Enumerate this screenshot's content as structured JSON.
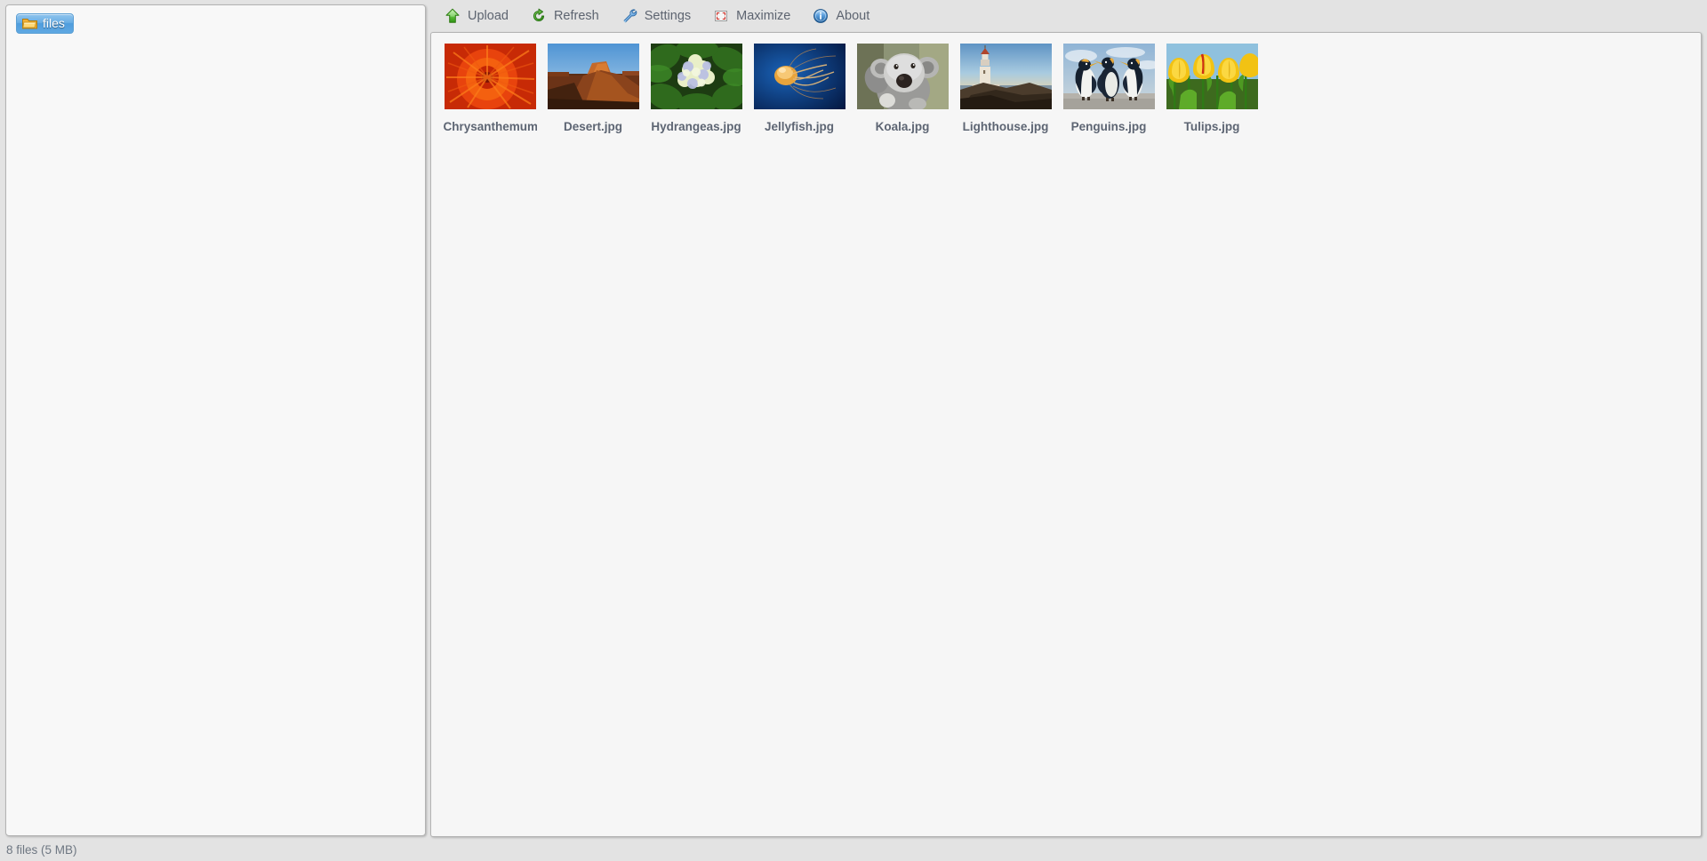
{
  "tree": {
    "root_label": "files",
    "root_icon": "folder-icon",
    "selected": true
  },
  "toolbar": {
    "items": [
      {
        "label": "Upload",
        "icon": "upload-arrow-icon"
      },
      {
        "label": "Refresh",
        "icon": "refresh-icon"
      },
      {
        "label": "Settings",
        "icon": "wrench-icon"
      },
      {
        "label": "Maximize",
        "icon": "maximize-icon"
      },
      {
        "label": "About",
        "icon": "info-icon"
      }
    ]
  },
  "content": {
    "files": [
      {
        "name": "Chrysanthemum.jpg",
        "display": "Chrysanthemum",
        "thumb": "chrysanthemum"
      },
      {
        "name": "Desert.jpg",
        "display": "Desert.jpg",
        "thumb": "desert"
      },
      {
        "name": "Hydrangeas.jpg",
        "display": "Hydrangeas.jpg",
        "thumb": "hydrangeas"
      },
      {
        "name": "Jellyfish.jpg",
        "display": "Jellyfish.jpg",
        "thumb": "jellyfish"
      },
      {
        "name": "Koala.jpg",
        "display": "Koala.jpg",
        "thumb": "koala"
      },
      {
        "name": "Lighthouse.jpg",
        "display": "Lighthouse.jpg",
        "thumb": "lighthouse"
      },
      {
        "name": "Penguins.jpg",
        "display": "Penguins.jpg",
        "thumb": "penguins"
      },
      {
        "name": "Tulips.jpg",
        "display": "Tulips.jpg",
        "thumb": "tulips"
      }
    ]
  },
  "status": {
    "text": "8 files (5 MB)",
    "file_count": 8,
    "total_size": "5 MB"
  },
  "colors": {
    "window_background": "#e3e3e3",
    "panel_background": "#f7f7f7",
    "panel_border": "#b4b4b4",
    "selection_blue": "#4f9ddd",
    "label_text": "#5d6573",
    "toolbar_text": "#5d6470",
    "status_text": "#6e7782"
  }
}
